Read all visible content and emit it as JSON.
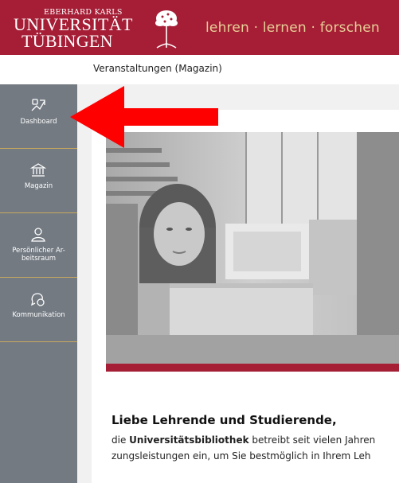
{
  "header": {
    "logo_small": "EBERHARD KARLS",
    "logo_uni": "UNIVERSITÄT",
    "logo_city": "TÜBINGEN",
    "tagline": "lehren · lernen · forschen",
    "bg_color": "#a51e36",
    "tagline_color": "#e7cf97"
  },
  "breadcrumb": {
    "current": "Veranstaltungen (Magazin)"
  },
  "sidebar": {
    "bg_color": "#737a82",
    "divider_color": "#c9a85d",
    "items": [
      {
        "label": "Dashboard",
        "icon": "dashboard-icon"
      },
      {
        "label": "Magazin",
        "icon": "bank-icon"
      },
      {
        "label_line1": "Persönlicher Ar-",
        "label_line2": "beitsraum",
        "icon": "user-icon"
      },
      {
        "label": "Kommunikation",
        "icon": "chat-icon"
      }
    ]
  },
  "content": {
    "welcome_heading": "Liebe Lehrende und Studierende,",
    "para_line1_pre": "die ",
    "para_line1_bold": "Universitätsbibliothek",
    "para_line1_post": " betreibt seit vielen Jahren",
    "para_line2": "zungsleistungen ein, um Sie bestmöglich in Ihrem Leh",
    "accent_color": "#a51e36"
  },
  "annotation": {
    "arrow_color": "#ff0000"
  }
}
